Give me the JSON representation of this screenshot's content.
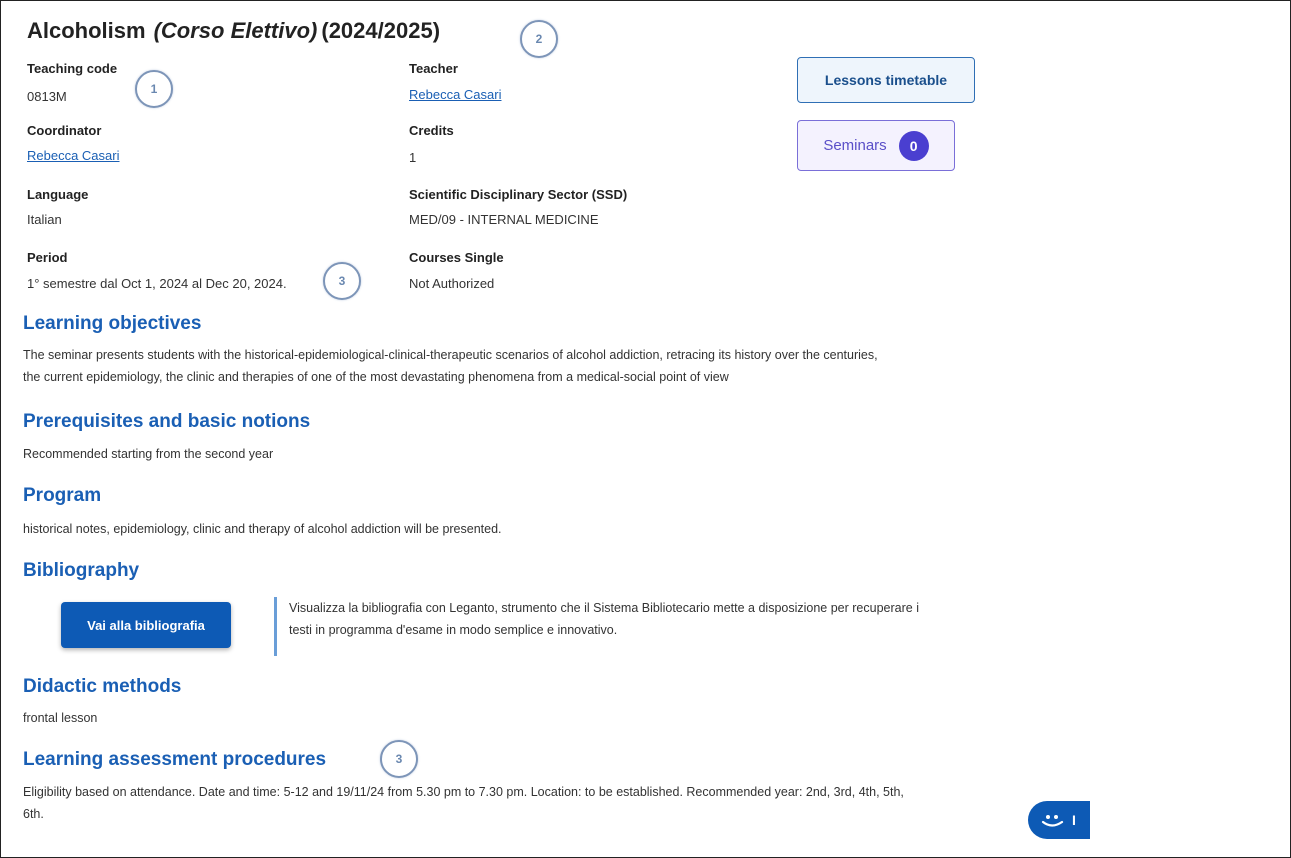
{
  "course": {
    "name": "Alcoholism",
    "type": "(Corso Elettivo)",
    "year": "(2024/2025)"
  },
  "fields": {
    "teaching_code": {
      "label": "Teaching code",
      "value": "0813M"
    },
    "teacher": {
      "label": "Teacher",
      "value": "Rebecca Casari"
    },
    "coordinator": {
      "label": "Coordinator",
      "value": "Rebecca Casari"
    },
    "credits": {
      "label": "Credits",
      "value": "1"
    },
    "language": {
      "label": "Language",
      "value": "Italian"
    },
    "ssd": {
      "label": "Scientific Disciplinary Sector (SSD)",
      "value": "MED/09 - INTERNAL MEDICINE"
    },
    "period": {
      "label": "Period",
      "value": "1° semestre dal Oct 1, 2024 al Dec 20, 2024."
    },
    "courses_single": {
      "label": "Courses Single",
      "value": "Not Authorized"
    }
  },
  "buttons": {
    "timetable": "Lessons timetable",
    "seminars": "Seminars",
    "seminars_count": "0",
    "bibliography": "Vai alla bibliografia"
  },
  "sections": {
    "objectives": {
      "heading": "Learning objectives",
      "line1": "The seminar presents students with the historical-epidemiological-clinical-therapeutic scenarios of alcohol addiction, retracing its history over the centuries,",
      "line2": "the current epidemiology, the clinic and therapies of one of the most devastating phenomena from a medical-social point of view"
    },
    "prerequisites": {
      "heading": "Prerequisites and basic notions",
      "text": "Recommended starting from the second year"
    },
    "program": {
      "heading": "Program",
      "text": "historical notes, epidemiology, clinic and therapy of alcohol addiction will be presented."
    },
    "bibliography": {
      "heading": "Bibliography",
      "note_line1": "Visualizza la bibliografia con Leganto, strumento che il Sistema Bibliotecario mette a disposizione per recuperare i",
      "note_line2": "testi in programma d'esame in modo semplice e innovativo."
    },
    "methods": {
      "heading": "Didactic methods",
      "text": "frontal lesson"
    },
    "assessment": {
      "heading": "Learning assessment procedures",
      "line1": "Eligibility based on attendance. Date and time: 5-12 and 19/11/24 from 5.30 pm to 7.30 pm. Location: to be established. Recommended year: 2nd, 3rd, 4th, 5th,",
      "line2": "6th."
    }
  },
  "callouts": {
    "a": "1",
    "b": "2",
    "c": "3",
    "d": "3"
  },
  "chat_widget": {
    "text": "I",
    "icon": "smile-chat-icon"
  }
}
